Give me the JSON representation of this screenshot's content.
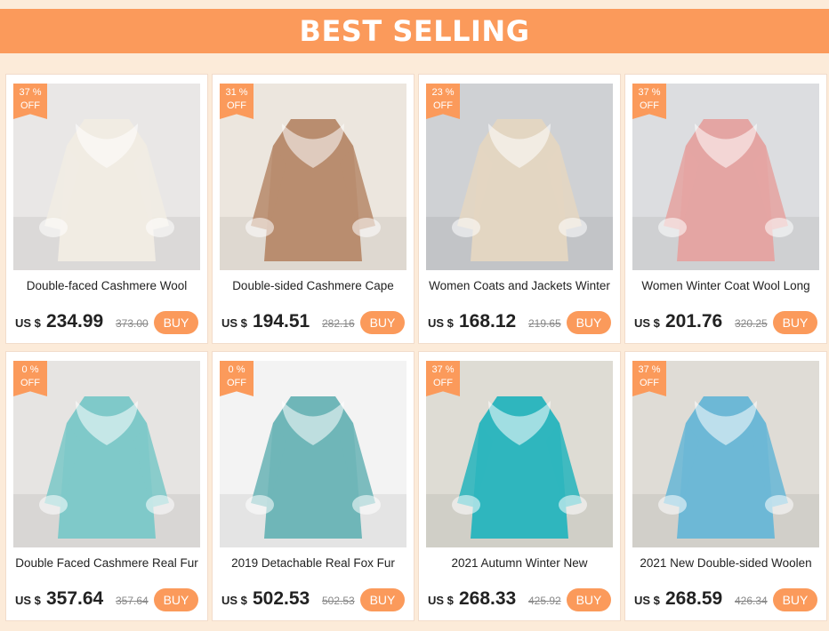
{
  "header": {
    "title": "BEST SELLING"
  },
  "colors": {
    "accent": "#fb9a5b",
    "background": "#fcebd9"
  },
  "products": [
    {
      "discount": "37 %",
      "off": "OFF",
      "title": "Double-faced Cashmere Wool",
      "currency": "US $",
      "price": "234.99",
      "old_price": "373.00",
      "buy_label": "BUY",
      "coat_color": "#f1ece3",
      "bg_color": "#e9e7e6"
    },
    {
      "discount": "31 %",
      "off": "OFF",
      "title": "Double-sided Cashmere Cape",
      "currency": "US $",
      "price": "194.51",
      "old_price": "282.16",
      "buy_label": "BUY",
      "coat_color": "#b98d6f",
      "bg_color": "#ece6de"
    },
    {
      "discount": "23 %",
      "off": "OFF",
      "title": "Women Coats and Jackets Winter",
      "currency": "US $",
      "price": "168.12",
      "old_price": "219.65",
      "buy_label": "BUY",
      "coat_color": "#e3d6c2",
      "bg_color": "#cfd1d4"
    },
    {
      "discount": "37 %",
      "off": "OFF",
      "title": "Women Winter Coat Wool Long",
      "currency": "US $",
      "price": "201.76",
      "old_price": "320.25",
      "buy_label": "BUY",
      "coat_color": "#e4a5a3",
      "bg_color": "#dcdde0"
    },
    {
      "discount": "0 %",
      "off": "OFF",
      "title": "Double Faced Cashmere Real Fur",
      "currency": "US $",
      "price": "357.64",
      "old_price": "357.64",
      "buy_label": "BUY",
      "coat_color": "#7fc9c9",
      "bg_color": "#e6e4e2"
    },
    {
      "discount": "0 %",
      "off": "OFF",
      "title": "2019 Detachable Real Fox Fur",
      "currency": "US $",
      "price": "502.53",
      "old_price": "502.53",
      "buy_label": "BUY",
      "coat_color": "#6fb6b8",
      "bg_color": "#f3f3f3"
    },
    {
      "discount": "37 %",
      "off": "OFF",
      "title": "2021 Autumn Winter New",
      "currency": "US $",
      "price": "268.33",
      "old_price": "425.92",
      "buy_label": "BUY",
      "coat_color": "#2fb6be",
      "bg_color": "#dedcd4"
    },
    {
      "discount": "37 %",
      "off": "OFF",
      "title": "2021 New Double-sided Woolen",
      "currency": "US $",
      "price": "268.59",
      "old_price": "426.34",
      "buy_label": "BUY",
      "coat_color": "#6db8d6",
      "bg_color": "#dfdcd6"
    }
  ]
}
